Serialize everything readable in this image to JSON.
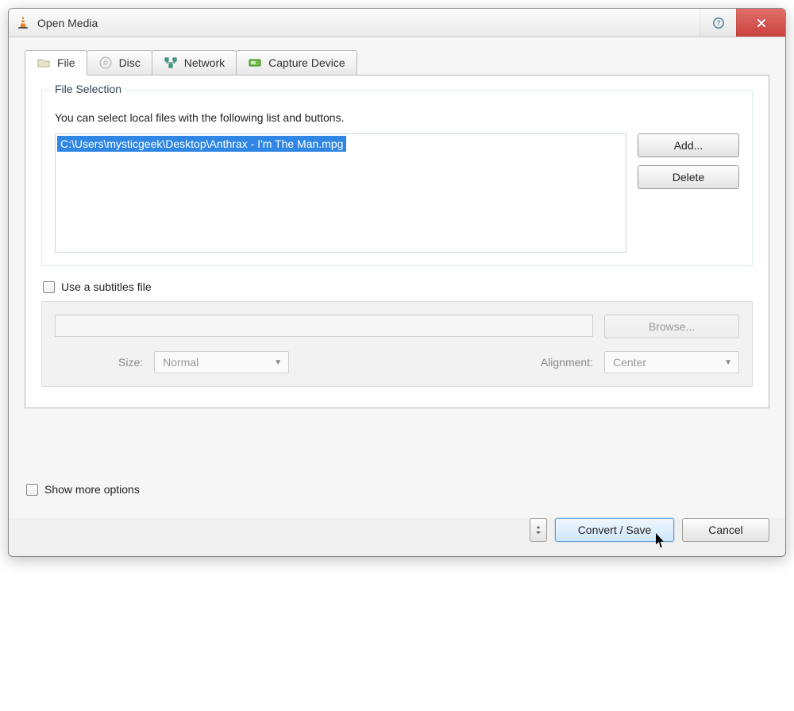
{
  "window": {
    "title": "Open Media"
  },
  "tabs": {
    "file": "File",
    "disc": "Disc",
    "network": "Network",
    "capture": "Capture Device"
  },
  "fileSelection": {
    "legend": "File Selection",
    "instruction": "You can select local files with the following list and buttons.",
    "selected_file": "C:\\Users\\mysticgeek\\Desktop\\Anthrax - I'm The Man.mpg",
    "add_label": "Add...",
    "delete_label": "Delete"
  },
  "subtitles": {
    "checkbox_label": "Use a subtitles file",
    "browse_label": "Browse...",
    "size_label": "Size:",
    "size_value": "Normal",
    "alignment_label": "Alignment:",
    "alignment_value": "Center"
  },
  "footer": {
    "more_options_label": "Show more options",
    "convert_label": "Convert / Save",
    "cancel_label": "Cancel"
  }
}
